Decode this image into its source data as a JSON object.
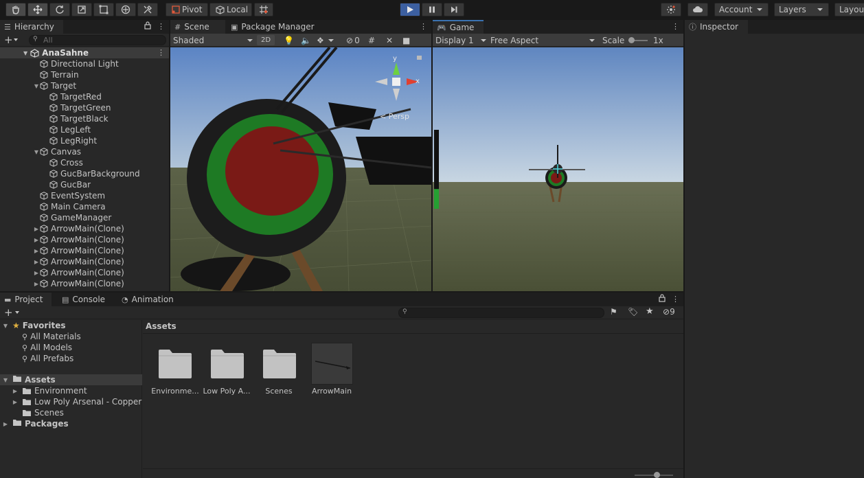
{
  "toolbar": {
    "pivot_label": "Pivot",
    "local_label": "Local",
    "account_label": "Account",
    "layers_label": "Layers",
    "layout_label": "Layou"
  },
  "hierarchy": {
    "tab_label": "Hierarchy",
    "search_placeholder": "All",
    "scene_name": "AnaSahne",
    "items": [
      {
        "label": "Directional Light",
        "indent": 1,
        "fold": ""
      },
      {
        "label": "Terrain",
        "indent": 1,
        "fold": ""
      },
      {
        "label": "Target",
        "indent": 1,
        "fold": "▼"
      },
      {
        "label": "TargetRed",
        "indent": 2,
        "fold": ""
      },
      {
        "label": "TargetGreen",
        "indent": 2,
        "fold": ""
      },
      {
        "label": "TargetBlack",
        "indent": 2,
        "fold": ""
      },
      {
        "label": "LegLeft",
        "indent": 2,
        "fold": ""
      },
      {
        "label": "LegRight",
        "indent": 2,
        "fold": ""
      },
      {
        "label": "Canvas",
        "indent": 1,
        "fold": "▼"
      },
      {
        "label": "Cross",
        "indent": 2,
        "fold": ""
      },
      {
        "label": "GucBarBackground",
        "indent": 2,
        "fold": ""
      },
      {
        "label": "GucBar",
        "indent": 2,
        "fold": ""
      },
      {
        "label": "EventSystem",
        "indent": 1,
        "fold": ""
      },
      {
        "label": "Main Camera",
        "indent": 1,
        "fold": ""
      },
      {
        "label": "GameManager",
        "indent": 1,
        "fold": ""
      },
      {
        "label": "ArrowMain(Clone)",
        "indent": 1,
        "fold": "▶"
      },
      {
        "label": "ArrowMain(Clone)",
        "indent": 1,
        "fold": "▶"
      },
      {
        "label": "ArrowMain(Clone)",
        "indent": 1,
        "fold": "▶"
      },
      {
        "label": "ArrowMain(Clone)",
        "indent": 1,
        "fold": "▶"
      },
      {
        "label": "ArrowMain(Clone)",
        "indent": 1,
        "fold": "▶"
      },
      {
        "label": "ArrowMain(Clone)",
        "indent": 1,
        "fold": "▶"
      }
    ]
  },
  "scene": {
    "tab_label": "Scene",
    "package_manager_label": "Package Manager",
    "shading_mode": "Shaded",
    "mode_2d": "2D",
    "hidden_count": "0",
    "gizmo_y": "y",
    "gizmo_x": "x",
    "persp_label": "< Persp"
  },
  "game": {
    "tab_label": "Game",
    "display": "Display 1",
    "aspect": "Free Aspect",
    "scale_label": "Scale",
    "scale_value": "1x",
    "power_bar_fill": 0.25
  },
  "inspector": {
    "tab_label": "Inspector"
  },
  "bottom": {
    "project_tab": "Project",
    "console_tab": "Console",
    "animation_tab": "Animation",
    "visible_count": "9",
    "breadcrumb": "Assets",
    "favorites_label": "Favorites",
    "favorites": [
      "All Materials",
      "All Models",
      "All Prefabs"
    ],
    "assets_label": "Assets",
    "asset_tree": [
      {
        "label": "Environment",
        "fold": "▶"
      },
      {
        "label": "Low Poly Arsenal - Copper",
        "fold": "▶"
      },
      {
        "label": "Scenes",
        "fold": ""
      }
    ],
    "packages_label": "Packages",
    "grid_items": [
      {
        "label": "Environme..."
      },
      {
        "label": "Low Poly A..."
      },
      {
        "label": "Scenes"
      },
      {
        "label": "ArrowMain"
      }
    ]
  },
  "colors": {
    "accent": "#3a72b0",
    "play_button": "#3c5fa0",
    "target_red": "#7a1a16",
    "target_green": "#1e7a24",
    "sky_top": "#5f86c0",
    "ground": "#4e5438"
  }
}
